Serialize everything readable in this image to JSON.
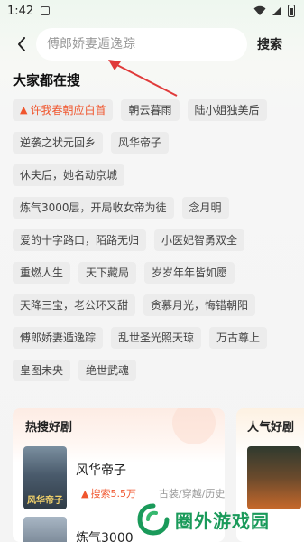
{
  "status_bar": {
    "time": "1:42"
  },
  "header": {
    "search_placeholder": "傅郎娇妻遁逸踪",
    "search_label": "搜索"
  },
  "hot_searches": {
    "title": "大家都在搜",
    "rows": [
      [
        {
          "label": "许我春朝应白首",
          "hot": true
        },
        {
          "label": "朝云暮雨"
        },
        {
          "label": "陆小姐独美后"
        }
      ],
      [
        {
          "label": "逆袭之状元回乡"
        },
        {
          "label": "风华帝子"
        }
      ],
      [
        {
          "label": "休夫后，她名动京城"
        }
      ],
      [
        {
          "label": "炼气3000层，开局收女帝为徒"
        },
        {
          "label": "念月明"
        }
      ],
      [
        {
          "label": "爱的十字路口，陌路无归"
        },
        {
          "label": "小医妃智勇双全"
        }
      ],
      [
        {
          "label": "重燃人生"
        },
        {
          "label": "天下藏局"
        },
        {
          "label": "岁岁年年皆如愿"
        }
      ],
      [
        {
          "label": "天降三宝，老公环又甜"
        },
        {
          "label": "贪慕月光，悔错朝阳"
        }
      ],
      [
        {
          "label": "傅郎娇妻遁逸踪"
        },
        {
          "label": "乱世圣光照天琼"
        },
        {
          "label": "万古尊上"
        }
      ],
      [
        {
          "label": "皇图未央"
        },
        {
          "label": "绝世武魂"
        }
      ]
    ]
  },
  "hot_dramas": {
    "title": "热搜好剧",
    "items": [
      {
        "name": "风华帝子",
        "cover_caption": "风华帝子",
        "heat": "搜索5.5万",
        "tags": "古装/穿越/历史"
      },
      {
        "name": "炼气3000"
      }
    ]
  },
  "popular_dramas": {
    "title": "人气好剧"
  },
  "watermark": {
    "text": "圈外游戏园"
  },
  "colors": {
    "accent": "#f0552d",
    "chip_bg": "#ececec",
    "watermark_green": "#1a9a5a"
  }
}
